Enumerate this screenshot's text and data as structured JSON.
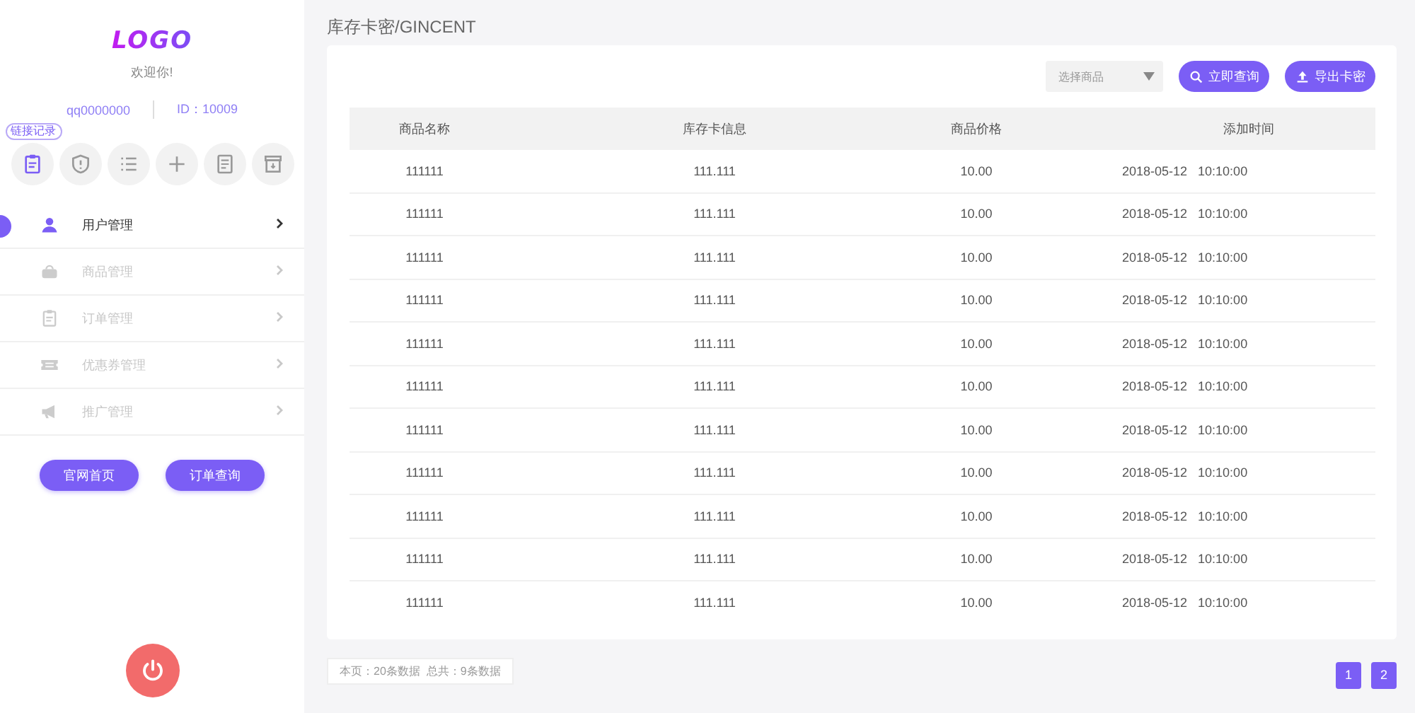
{
  "sidebar": {
    "logo": "LOGO",
    "welcome": "欢迎你!",
    "account": "qq0000000",
    "user_id": "ID：10009",
    "quick_icons": [
      {
        "kind": "clipboard",
        "tooltip": "链接记录",
        "selected": true
      },
      {
        "kind": "shield",
        "selected": false
      },
      {
        "kind": "list",
        "selected": false
      },
      {
        "kind": "plus",
        "selected": false
      },
      {
        "kind": "document",
        "selected": false
      },
      {
        "kind": "archive",
        "selected": false
      }
    ],
    "nav": [
      {
        "label": "用户管理",
        "kind": "user",
        "selected": true
      },
      {
        "label": "商品管理",
        "kind": "basket",
        "selected": false
      },
      {
        "label": "订单管理",
        "kind": "clipboard",
        "selected": false
      },
      {
        "label": "优惠券管理",
        "kind": "ticket",
        "selected": false
      },
      {
        "label": "推广管理",
        "kind": "megaphone",
        "selected": false
      }
    ],
    "buttons": [
      "官网首页",
      "订单查询"
    ]
  },
  "main": {
    "breadcrumb": "库存卡密/GINCENT",
    "filter": {
      "placeholder": "选择商品"
    },
    "buttons": [
      {
        "label": "立即查询",
        "kind": "search"
      },
      {
        "label": "导出卡密",
        "kind": "upload"
      }
    ],
    "table": {
      "columns": [
        "商品名称",
        "库存卡信息",
        "商品价格",
        "添加时间"
      ],
      "rows": [
        [
          "111111",
          "111.111",
          "10.00",
          "2018-05-12   10:10:00"
        ],
        [
          "111111",
          "111.111",
          "10.00",
          "2018-05-12   10:10:00"
        ],
        [
          "111111",
          "111.111",
          "10.00",
          "2018-05-12   10:10:00"
        ],
        [
          "111111",
          "111.111",
          "10.00",
          "2018-05-12   10:10:00"
        ],
        [
          "111111",
          "111.111",
          "10.00",
          "2018-05-12   10:10:00"
        ],
        [
          "111111",
          "111.111",
          "10.00",
          "2018-05-12   10:10:00"
        ],
        [
          "111111",
          "111.111",
          "10.00",
          "2018-05-12   10:10:00"
        ],
        [
          "111111",
          "111.111",
          "10.00",
          "2018-05-12   10:10:00"
        ],
        [
          "111111",
          "111.111",
          "10.00",
          "2018-05-12   10:10:00"
        ],
        [
          "111111",
          "111.111",
          "10.00",
          "2018-05-12   10:10:00"
        ],
        [
          "111111",
          "111.111",
          "10.00",
          "2018-05-12   10:10:00"
        ]
      ]
    },
    "summary": "本页：20条数据  总共：9条数据",
    "pages": [
      "1",
      "2"
    ]
  }
}
